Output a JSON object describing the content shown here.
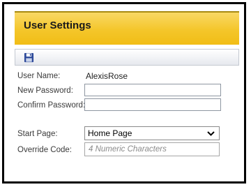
{
  "header": {
    "title": "User Settings"
  },
  "toolbar": {
    "save_icon": "floppy-disk-save-icon"
  },
  "form": {
    "user_name_label": "User Name:",
    "user_name_value": "AlexisRose",
    "new_password_label": "New Password:",
    "new_password_value": "",
    "confirm_password_label": "Confirm Password:",
    "confirm_password_value": "",
    "start_page_label": "Start Page:",
    "start_page_value": "Home Page",
    "override_code_label": "Override Code:",
    "override_code_value": "",
    "override_code_placeholder": "4 Numeric Characters"
  },
  "colors": {
    "title_bar": "#f4c62a",
    "frame_border": "#000000",
    "save_icon": "#2e4a9a"
  }
}
